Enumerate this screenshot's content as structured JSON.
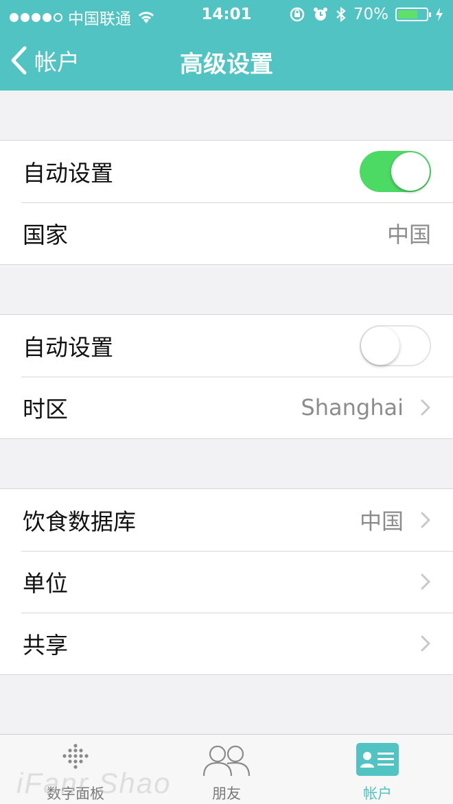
{
  "status_bar": {
    "carrier": "中国联通",
    "time": "14:01",
    "battery": "70%",
    "battery_level": 0.7
  },
  "nav": {
    "back_label": "帐户",
    "title": "高级设置"
  },
  "groups": [
    {
      "rows": [
        {
          "label": "自动设置",
          "toggle": true
        },
        {
          "label": "国家",
          "value": "中国"
        }
      ]
    },
    {
      "rows": [
        {
          "label": "自动设置",
          "toggle": false
        },
        {
          "label": "时区",
          "value": "Shanghai",
          "chevron": true
        }
      ]
    },
    {
      "rows": [
        {
          "label": "饮食数据库",
          "value": "中国",
          "chevron": true
        },
        {
          "label": "单位",
          "chevron": true
        },
        {
          "label": "共享",
          "chevron": true
        }
      ]
    }
  ],
  "tab_bar": {
    "tabs": [
      {
        "label": "数字面板",
        "icon": "dots-grid-icon"
      },
      {
        "label": "朋友",
        "icon": "friends-icon"
      },
      {
        "label": "帐户",
        "icon": "account-card-icon",
        "active": true
      }
    ]
  },
  "watermark": "iFanr Shao",
  "colors": {
    "accent": "#50c3c2",
    "toggle_on": "#4cd964",
    "value_text": "#8c8c8e"
  }
}
